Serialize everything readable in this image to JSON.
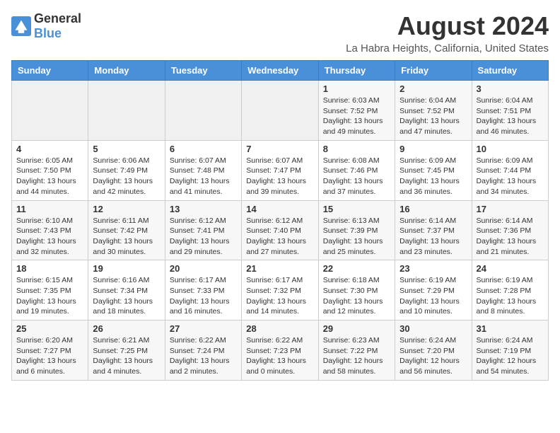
{
  "header": {
    "logo_general": "General",
    "logo_blue": "Blue",
    "month_title": "August 2024",
    "location": "La Habra Heights, California, United States"
  },
  "days_of_week": [
    "Sunday",
    "Monday",
    "Tuesday",
    "Wednesday",
    "Thursday",
    "Friday",
    "Saturday"
  ],
  "weeks": [
    [
      {
        "day": "",
        "info": ""
      },
      {
        "day": "",
        "info": ""
      },
      {
        "day": "",
        "info": ""
      },
      {
        "day": "",
        "info": ""
      },
      {
        "day": "1",
        "info": "Sunrise: 6:03 AM\nSunset: 7:52 PM\nDaylight: 13 hours\nand 49 minutes."
      },
      {
        "day": "2",
        "info": "Sunrise: 6:04 AM\nSunset: 7:52 PM\nDaylight: 13 hours\nand 47 minutes."
      },
      {
        "day": "3",
        "info": "Sunrise: 6:04 AM\nSunset: 7:51 PM\nDaylight: 13 hours\nand 46 minutes."
      }
    ],
    [
      {
        "day": "4",
        "info": "Sunrise: 6:05 AM\nSunset: 7:50 PM\nDaylight: 13 hours\nand 44 minutes."
      },
      {
        "day": "5",
        "info": "Sunrise: 6:06 AM\nSunset: 7:49 PM\nDaylight: 13 hours\nand 42 minutes."
      },
      {
        "day": "6",
        "info": "Sunrise: 6:07 AM\nSunset: 7:48 PM\nDaylight: 13 hours\nand 41 minutes."
      },
      {
        "day": "7",
        "info": "Sunrise: 6:07 AM\nSunset: 7:47 PM\nDaylight: 13 hours\nand 39 minutes."
      },
      {
        "day": "8",
        "info": "Sunrise: 6:08 AM\nSunset: 7:46 PM\nDaylight: 13 hours\nand 37 minutes."
      },
      {
        "day": "9",
        "info": "Sunrise: 6:09 AM\nSunset: 7:45 PM\nDaylight: 13 hours\nand 36 minutes."
      },
      {
        "day": "10",
        "info": "Sunrise: 6:09 AM\nSunset: 7:44 PM\nDaylight: 13 hours\nand 34 minutes."
      }
    ],
    [
      {
        "day": "11",
        "info": "Sunrise: 6:10 AM\nSunset: 7:43 PM\nDaylight: 13 hours\nand 32 minutes."
      },
      {
        "day": "12",
        "info": "Sunrise: 6:11 AM\nSunset: 7:42 PM\nDaylight: 13 hours\nand 30 minutes."
      },
      {
        "day": "13",
        "info": "Sunrise: 6:12 AM\nSunset: 7:41 PM\nDaylight: 13 hours\nand 29 minutes."
      },
      {
        "day": "14",
        "info": "Sunrise: 6:12 AM\nSunset: 7:40 PM\nDaylight: 13 hours\nand 27 minutes."
      },
      {
        "day": "15",
        "info": "Sunrise: 6:13 AM\nSunset: 7:39 PM\nDaylight: 13 hours\nand 25 minutes."
      },
      {
        "day": "16",
        "info": "Sunrise: 6:14 AM\nSunset: 7:37 PM\nDaylight: 13 hours\nand 23 minutes."
      },
      {
        "day": "17",
        "info": "Sunrise: 6:14 AM\nSunset: 7:36 PM\nDaylight: 13 hours\nand 21 minutes."
      }
    ],
    [
      {
        "day": "18",
        "info": "Sunrise: 6:15 AM\nSunset: 7:35 PM\nDaylight: 13 hours\nand 19 minutes."
      },
      {
        "day": "19",
        "info": "Sunrise: 6:16 AM\nSunset: 7:34 PM\nDaylight: 13 hours\nand 18 minutes."
      },
      {
        "day": "20",
        "info": "Sunrise: 6:17 AM\nSunset: 7:33 PM\nDaylight: 13 hours\nand 16 minutes."
      },
      {
        "day": "21",
        "info": "Sunrise: 6:17 AM\nSunset: 7:32 PM\nDaylight: 13 hours\nand 14 minutes."
      },
      {
        "day": "22",
        "info": "Sunrise: 6:18 AM\nSunset: 7:30 PM\nDaylight: 13 hours\nand 12 minutes."
      },
      {
        "day": "23",
        "info": "Sunrise: 6:19 AM\nSunset: 7:29 PM\nDaylight: 13 hours\nand 10 minutes."
      },
      {
        "day": "24",
        "info": "Sunrise: 6:19 AM\nSunset: 7:28 PM\nDaylight: 13 hours\nand 8 minutes."
      }
    ],
    [
      {
        "day": "25",
        "info": "Sunrise: 6:20 AM\nSunset: 7:27 PM\nDaylight: 13 hours\nand 6 minutes."
      },
      {
        "day": "26",
        "info": "Sunrise: 6:21 AM\nSunset: 7:25 PM\nDaylight: 13 hours\nand 4 minutes."
      },
      {
        "day": "27",
        "info": "Sunrise: 6:22 AM\nSunset: 7:24 PM\nDaylight: 13 hours\nand 2 minutes."
      },
      {
        "day": "28",
        "info": "Sunrise: 6:22 AM\nSunset: 7:23 PM\nDaylight: 13 hours\nand 0 minutes."
      },
      {
        "day": "29",
        "info": "Sunrise: 6:23 AM\nSunset: 7:22 PM\nDaylight: 12 hours\nand 58 minutes."
      },
      {
        "day": "30",
        "info": "Sunrise: 6:24 AM\nSunset: 7:20 PM\nDaylight: 12 hours\nand 56 minutes."
      },
      {
        "day": "31",
        "info": "Sunrise: 6:24 AM\nSunset: 7:19 PM\nDaylight: 12 hours\nand 54 minutes."
      }
    ]
  ]
}
